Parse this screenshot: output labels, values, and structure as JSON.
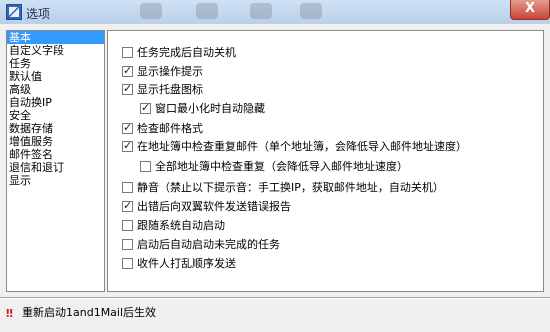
{
  "window": {
    "title": "选项",
    "close_label": "X"
  },
  "sidebar": {
    "items": [
      {
        "label": "基本",
        "selected": true
      },
      {
        "label": "自定义字段",
        "selected": false
      },
      {
        "label": "任务",
        "selected": false
      },
      {
        "label": "默认值",
        "selected": false
      },
      {
        "label": "高级",
        "selected": false
      },
      {
        "label": "自动换IP",
        "selected": false
      },
      {
        "label": "安全",
        "selected": false
      },
      {
        "label": "数据存储",
        "selected": false
      },
      {
        "label": "增值服务",
        "selected": false
      },
      {
        "label": "邮件签名",
        "selected": false
      },
      {
        "label": "退信和退订",
        "selected": false
      },
      {
        "label": "显示",
        "selected": false
      }
    ]
  },
  "options": [
    {
      "label": "任务完成后自动关机",
      "checked": false
    },
    {
      "label": "显示操作提示",
      "checked": true
    },
    {
      "label": "显示托盘图标",
      "checked": true
    },
    {
      "label": "窗口最小化时自动隐藏",
      "checked": true
    },
    {
      "label": "检查邮件格式",
      "checked": true
    },
    {
      "label": "在地址簿中检查重复邮件（单个地址簿，会降低导入邮件地址速度）",
      "checked": true
    },
    {
      "label": "全部地址簿中检查重复（会降低导入邮件地址速度）",
      "checked": false
    },
    {
      "label": "静音（禁止以下提示音：手工换IP，获取邮件地址，自动关机）",
      "checked": false
    },
    {
      "label": "出错后向双翼软件发送错误报告",
      "checked": true
    },
    {
      "label": "跟随系统自动启动",
      "checked": false
    },
    {
      "label": "启动后自动启动未完成的任务",
      "checked": false
    },
    {
      "label": "收件人打乱顺序发送",
      "checked": false
    }
  ],
  "status": {
    "text": "重新启动1and1Mail后生效",
    "icon": "restart-required-icon",
    "icon_color": "#d11a1a"
  },
  "colors": {
    "selection": "#3399ff",
    "frame": "#f0f0f0"
  }
}
